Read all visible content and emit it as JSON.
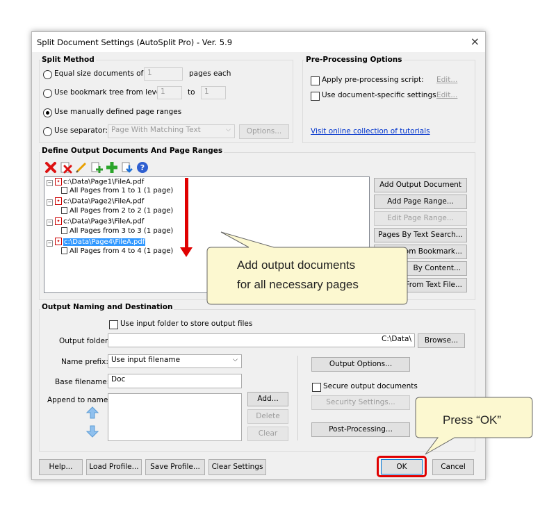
{
  "window": {
    "title": "Split Document Settings (AutoSplit Pro) - Ver. 5.9",
    "close_glyph": "×"
  },
  "split_method": {
    "title": "Split Method",
    "equal_size": {
      "label": "Equal size documents of",
      "value": "1",
      "suffix": "pages each"
    },
    "bookmark": {
      "label": "Use bookmark tree from level",
      "from": "1",
      "to_label": "to",
      "to": "1"
    },
    "manual": {
      "label": "Use manually defined page ranges"
    },
    "separator": {
      "label": "Use separator:",
      "selected": "Page With Matching Text",
      "options_button": "Options..."
    }
  },
  "pre_processing": {
    "title": "Pre-Processing Options",
    "apply_script": {
      "label": "Apply pre-processing script:",
      "edit": "Edit..."
    },
    "doc_specific": {
      "label": "Use document-specific settings:",
      "edit": "Edit..."
    },
    "tutorials_link": "Visit online collection of tutorials"
  },
  "define_output": {
    "title": "Define Output Documents And Page Ranges",
    "toolbar_icons": [
      "delete-icon",
      "delete-all-icon",
      "edit-pencil-icon",
      "add-doc-icon",
      "add-green-plus-icon",
      "import-icon",
      "help-icon"
    ],
    "tree": [
      {
        "file": "c:\\Data\\Page1\\FileA.pdf",
        "range": "All Pages from 1 to 1 (1 page)"
      },
      {
        "file": "c:\\Data\\Page2\\FileA.pdf",
        "range": "All Pages from 2 to 2 (1 page)"
      },
      {
        "file": "c:\\Data\\Page3\\FileA.pdf",
        "range": "All Pages from 3 to 3 (1 page)"
      },
      {
        "file": "c:\\Data\\Page4\\FileA.pdf",
        "range": "All Pages from 4 to 4 (1 page)"
      }
    ],
    "buttons": {
      "add_output": "Add Output Document",
      "add_range": "Add Page Range...",
      "edit_range": "Edit Page Range...",
      "by_text": "Pages By Text Search...",
      "from_bookmark": "From Bookmark...",
      "by_content": "By Content...",
      "from_text_file": "From Text File..."
    }
  },
  "output_naming": {
    "title": "Output Naming and Destination",
    "use_input_folder": "Use input folder to store output files",
    "output_folder_label": "Output folder:",
    "output_folder_value": "C:\\Data\\",
    "browse": "Browse...",
    "name_prefix_label": "Name prefix:",
    "name_prefix_value": "Use input filename",
    "base_filename_label": "Base filename:",
    "base_filename_value": "Doc",
    "append_label": "Append to name:",
    "add": "Add...",
    "delete": "Delete",
    "clear": "Clear",
    "output_options": "Output Options...",
    "secure": "Secure output documents",
    "security_settings": "Security Settings...",
    "post_processing": "Post-Processing..."
  },
  "footer": {
    "help": "Help...",
    "load_profile": "Load Profile...",
    "save_profile": "Save Profile...",
    "clear_settings": "Clear Settings",
    "ok": "OK",
    "cancel": "Cancel"
  },
  "annotations": {
    "callout_main_line1": "Add output documents",
    "callout_main_line2": "for all necessary pages",
    "callout_ok": "Press “OK”"
  },
  "colors": {
    "accent_red": "#e00000",
    "callout_fill": "#fcf8d0",
    "link_blue": "#0033cc",
    "selection_blue": "#3399ff"
  }
}
